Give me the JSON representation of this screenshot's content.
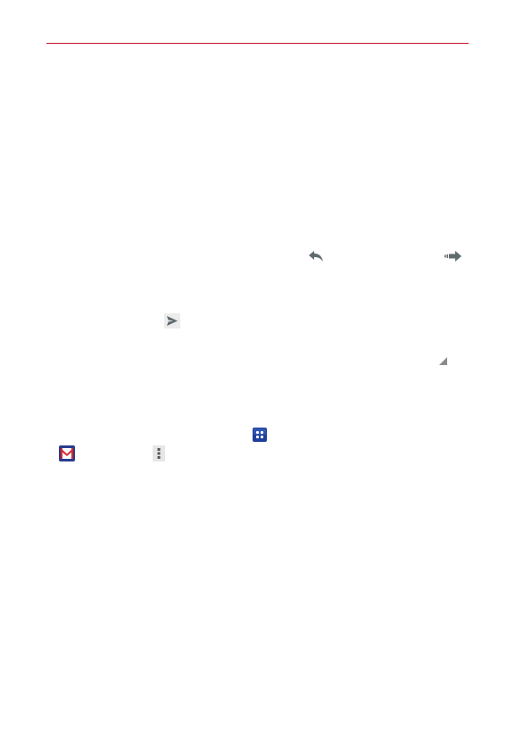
{
  "page": {
    "rule_color": "#c8102e"
  },
  "icons": {
    "reply": "reply-icon",
    "forward": "forward-icon",
    "send": "send-icon",
    "resize": "resize-handle-icon",
    "apps": "apps-icon",
    "gmail": "gmail-icon",
    "menu": "menu-icon"
  },
  "colors": {
    "icon_gray": "#5f6b6e",
    "apps_blue": "#1f3f9a",
    "gmail_red": "#d92828"
  }
}
